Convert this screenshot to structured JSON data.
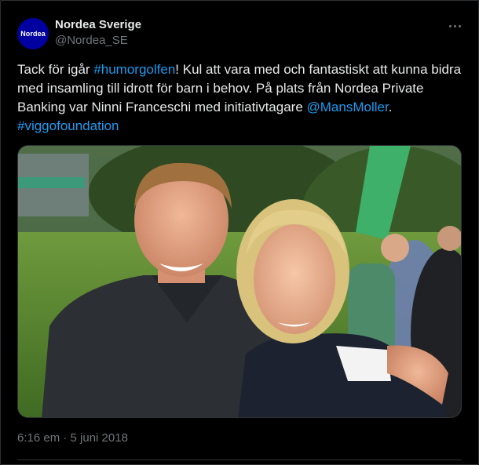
{
  "author": {
    "display_name": "Nordea Sverige",
    "handle": "@Nordea_SE",
    "avatar_text": "Nordea",
    "avatar_color": "#0000a0"
  },
  "tweet": {
    "segments": [
      {
        "text": "Tack för igår ",
        "link": false
      },
      {
        "text": "#humorgolfen",
        "link": true
      },
      {
        "text": "! Kul att vara med och fantastiskt att kunna bidra med insamling till idrott för barn i behov. På plats från Nordea Private Banking var Ninni Franceschi med initiativtagare ",
        "link": false
      },
      {
        "text": "@MansMoller",
        "link": true
      },
      {
        "text": ". ",
        "link": false
      },
      {
        "text": "#viggofoundation",
        "link": true
      }
    ],
    "timestamp": "6:16 em · 5 juni 2018"
  },
  "media": {
    "description_icon": "photo-icon"
  },
  "colors": {
    "background": "#000000",
    "text": "#e7e9ea",
    "muted": "#71767b",
    "link": "#1d9bf0",
    "border": "#2f3336"
  },
  "icons": {
    "more": "more-horizontal-icon"
  }
}
